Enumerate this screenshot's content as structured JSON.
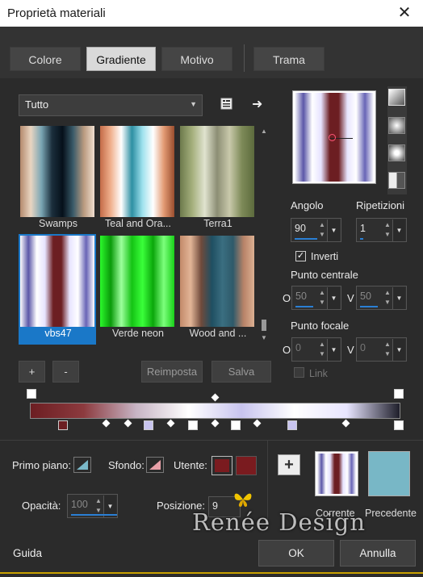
{
  "window": {
    "title": "Proprietà materiali",
    "close_glyph": "✕"
  },
  "tabs": [
    {
      "label": "Colore",
      "active": false
    },
    {
      "label": "Gradiente",
      "active": true
    },
    {
      "label": "Motivo",
      "active": false
    },
    {
      "label": "Trama",
      "active": false
    }
  ],
  "library": {
    "category": "Tutto",
    "gradients": [
      {
        "name": "Swamps",
        "colors": [
          "#b4896d",
          "#e9d5c1",
          "#7aa6b4",
          "#1b2e3c",
          "#05101a",
          "#3a5b6a",
          "#b99a7f",
          "#f0dfd0"
        ]
      },
      {
        "name": "Teal and Ora...",
        "colors": [
          "#c46b48",
          "#f0b08d",
          "#ffffff",
          "#2d8fa3",
          "#9fe2ee",
          "#ffffff",
          "#e39b74",
          "#9a4d2e"
        ]
      },
      {
        "name": "Terra1",
        "colors": [
          "#6d7a4c",
          "#a5b07d",
          "#e0e3cf",
          "#8c8e74",
          "#c9c9ab",
          "#7d8a58",
          "#5d6b3d"
        ]
      },
      {
        "name": "vbs47",
        "colors": [
          "#ffffff",
          "#5b57a8",
          "#ffffff",
          "#e6e3ff",
          "#6c1e22",
          "#6c1e22",
          "#e8e5ff",
          "#ffffff",
          "#6864b6",
          "#ffffff"
        ]
      },
      {
        "name": "Verde neon",
        "colors": [
          "#2bfa2b",
          "#0a9a0a",
          "#9dff9d",
          "#14c314",
          "#3aff3a",
          "#0ba70b",
          "#7cff7c",
          "#18d018"
        ]
      },
      {
        "name": "Wood and ...",
        "colors": [
          "#c38a6a",
          "#e2b597",
          "#6f4a3b",
          "#1f4f62",
          "#3a6e80",
          "#2e5a6a",
          "#b88368",
          "#dcb092"
        ]
      }
    ],
    "selected": "vbs47"
  },
  "buttons": {
    "add": "+",
    "remove": "-",
    "reset": "Reimposta",
    "save": "Salva"
  },
  "shape_icon_name": "gradient-library-icon",
  "swap_icon_name": "arrow-right-icon",
  "preview": {
    "colors": [
      "#ffffff",
      "#5b57a8",
      "#ffffff",
      "#e6e3ff",
      "#6c1e22",
      "#6c1e22",
      "#e8e5ff",
      "#ffffff",
      "#6864b6",
      "#ffffff"
    ]
  },
  "angle": {
    "label": "Angolo",
    "value": "90"
  },
  "repeats": {
    "label": "Ripetizioni",
    "value": "1"
  },
  "invert": {
    "label": "Inverti",
    "checked": true
  },
  "center_point": {
    "label": "Punto centrale",
    "o_label": "O",
    "v_label": "V",
    "o_value": "50",
    "v_value": "50"
  },
  "focal_point": {
    "label": "Punto focale",
    "o_label": "O",
    "v_label": "V",
    "o_value": "0",
    "v_value": "0"
  },
  "link": {
    "label": "Link"
  },
  "editor_bar": {
    "colors": [
      "#6c1e22",
      "#8c3a3e",
      "#c7b4c4",
      "#ffffff",
      "#c8c4ee",
      "#ffffff",
      "#e8e5ff",
      "#1e1e2a"
    ]
  },
  "primo_piano": {
    "label": "Primo piano:"
  },
  "sfondo": {
    "label": "Sfondo:"
  },
  "utente": {
    "label": "Utente:",
    "color": "#7a1b1f"
  },
  "opacity": {
    "label": "Opacità:",
    "value": "100"
  },
  "position": {
    "label": "Posizione:",
    "value": "9"
  },
  "current": {
    "label": "Corrente"
  },
  "previous": {
    "label": "Precedente",
    "color": "#78b7c6"
  },
  "watermark": "Renée Design",
  "footer": {
    "help": "Guida",
    "ok": "OK",
    "cancel": "Annulla"
  }
}
